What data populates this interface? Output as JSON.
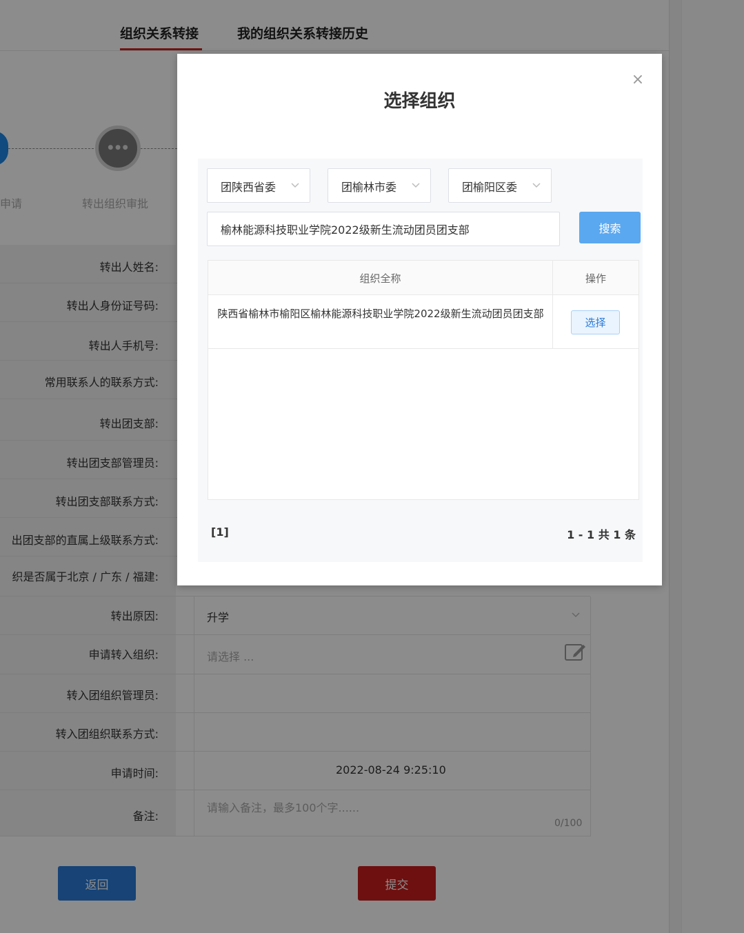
{
  "tabs": [
    {
      "label": "组织关系转接",
      "active": true
    },
    {
      "label": "我的组织关系转接历史",
      "active": false
    }
  ],
  "steps": [
    {
      "label": "申请"
    },
    {
      "label": "转出组织审批",
      "circle_text": "● ● ●"
    }
  ],
  "form": {
    "rows": [
      {
        "label": "转出人姓名:",
        "value": ""
      },
      {
        "label": "转出人身份证号码:",
        "value": ""
      },
      {
        "label": "转出人手机号:",
        "value": ""
      },
      {
        "label": "常用联系人的联系方式:",
        "value": ""
      },
      {
        "label": "转出团支部:",
        "value": ""
      },
      {
        "label": "转出团支部管理员:",
        "value": ""
      },
      {
        "label": "转出团支部联系方式:",
        "value": ""
      },
      {
        "label": "出团支部的直属上级联系方式:",
        "value": ""
      },
      {
        "label": "织是否属于北京 / 广东 / 福建:",
        "value": ""
      },
      {
        "label": "转出原因:",
        "value": "升学"
      },
      {
        "label": "申请转入组织:",
        "placeholder": "请选择 ..."
      },
      {
        "label": "转入团组织管理员:",
        "value": ""
      },
      {
        "label": "转入团组织联系方式:",
        "value": ""
      },
      {
        "label": "申请时间:",
        "value": "2022-08-24 9:25:10"
      },
      {
        "label": "备注:",
        "placeholder": "请输入备注，最多100个字......"
      }
    ],
    "remark_counter": "0/100",
    "back_label": "返回",
    "submit_label": "提交"
  },
  "modal": {
    "title": "选择组织",
    "close_symbol": "×",
    "filters": {
      "province": "团陕西省委",
      "city": "团榆林市委",
      "district": "团榆阳区委"
    },
    "search": {
      "value": "榆林能源科技职业学院2022级新生流动团员团支部",
      "button_label": "搜索"
    },
    "table": {
      "columns": [
        "组织全称",
        "操作"
      ],
      "rows": [
        {
          "name": "陕西省榆林市榆阳区榆林能源科技职业学院2022级新生流动团员团支部",
          "action": "选择"
        }
      ]
    },
    "pager": {
      "page": "[1]",
      "summary": "1 - 1 共 1 条"
    }
  },
  "colors": {
    "accent_red": "#c9241f",
    "primary_blue": "#2a7ad8",
    "search_blue": "#5aa8f0"
  }
}
